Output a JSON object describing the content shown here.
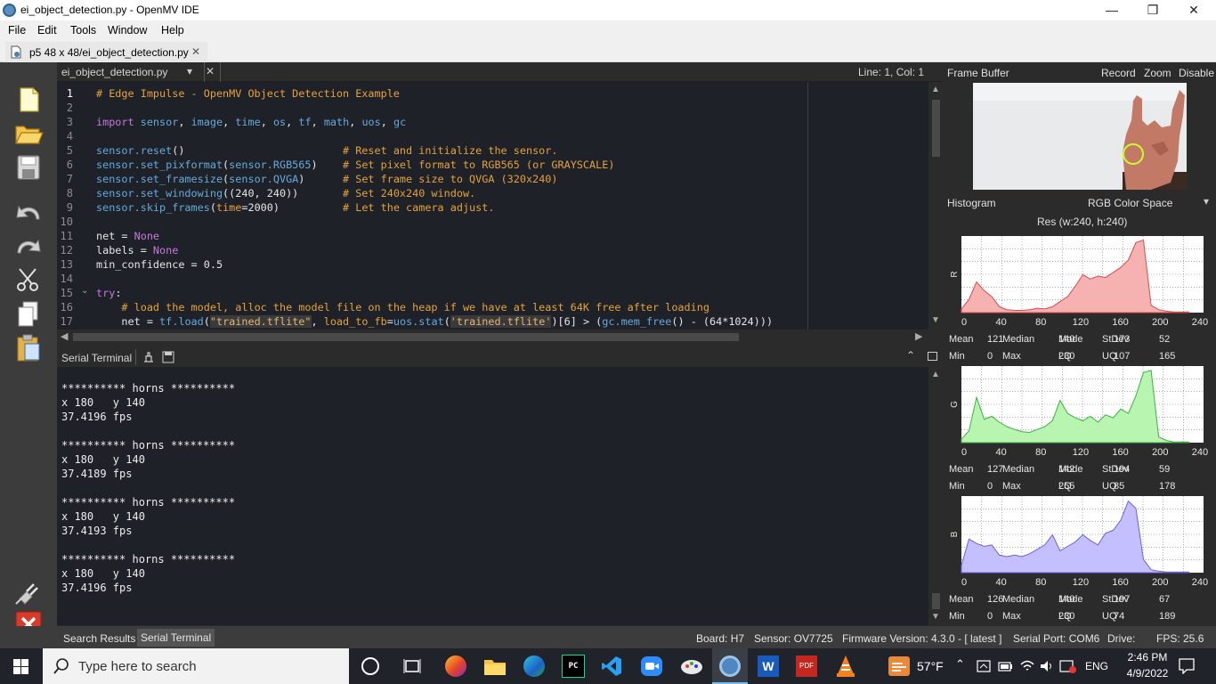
{
  "window": {
    "title": "ei_object_detection.py - OpenMV IDE",
    "minimize": "—",
    "maximize": "❐",
    "close": "✕"
  },
  "menu": [
    "File",
    "Edit",
    "Tools",
    "Window",
    "Help"
  ],
  "doc_tab": {
    "label": "p5 48 x 48/ei_object_detection.py",
    "close": "✕"
  },
  "editor": {
    "file_selector": "ei_object_detection.py",
    "file_selector_arrow": "▾",
    "file_close": "✕",
    "cursor_pos": "Line: 1, Col: 1",
    "lines": [
      {
        "n": "1",
        "parts": [
          [
            "c-cm",
            "# Edge Impulse - OpenMV Object Detection Example"
          ]
        ]
      },
      {
        "n": "2",
        "parts": []
      },
      {
        "n": "3",
        "parts": [
          [
            "c-kw",
            "import "
          ],
          [
            "c-fn",
            "sensor"
          ],
          [
            "c-pl",
            ", "
          ],
          [
            "c-fn",
            "image"
          ],
          [
            "c-pl",
            ", "
          ],
          [
            "c-fn",
            "time"
          ],
          [
            "c-pl",
            ", "
          ],
          [
            "c-fn",
            "os"
          ],
          [
            "c-pl",
            ", "
          ],
          [
            "c-fn",
            "tf"
          ],
          [
            "c-pl",
            ", "
          ],
          [
            "c-fn",
            "math"
          ],
          [
            "c-pl",
            ", "
          ],
          [
            "c-fn",
            "uos"
          ],
          [
            "c-pl",
            ", "
          ],
          [
            "c-fn",
            "gc"
          ]
        ]
      },
      {
        "n": "4",
        "parts": []
      },
      {
        "n": "5",
        "parts": [
          [
            "c-fn",
            "sensor.reset"
          ],
          [
            "c-pl",
            "()                         "
          ],
          [
            "c-cm",
            "# Reset and initialize the sensor."
          ]
        ]
      },
      {
        "n": "6",
        "parts": [
          [
            "c-fn",
            "sensor.set_pixformat"
          ],
          [
            "c-pl",
            "("
          ],
          [
            "c-fn",
            "sensor.RGB565"
          ],
          [
            "c-pl",
            ")    "
          ],
          [
            "c-cm",
            "# Set pixel format to RGB565 (or GRAYSCALE)"
          ]
        ]
      },
      {
        "n": "7",
        "parts": [
          [
            "c-fn",
            "sensor.set_framesize"
          ],
          [
            "c-pl",
            "("
          ],
          [
            "c-fn",
            "sensor.QVGA"
          ],
          [
            "c-pl",
            ")      "
          ],
          [
            "c-cm",
            "# Set frame size to QVGA (320x240)"
          ]
        ]
      },
      {
        "n": "8",
        "parts": [
          [
            "c-fn",
            "sensor.set_windowing"
          ],
          [
            "c-pl",
            "((240, 240))       "
          ],
          [
            "c-cm",
            "# Set 240x240 window."
          ]
        ]
      },
      {
        "n": "9",
        "parts": [
          [
            "c-fn",
            "sensor.skip_frames"
          ],
          [
            "c-pl",
            "("
          ],
          [
            "c-cm",
            "time"
          ],
          [
            "c-pl",
            "=2000)          "
          ],
          [
            "c-cm",
            "# Let the camera adjust."
          ]
        ]
      },
      {
        "n": "10",
        "parts": []
      },
      {
        "n": "11",
        "parts": [
          [
            "c-pl",
            "net = "
          ],
          [
            "c-kw",
            "None"
          ]
        ]
      },
      {
        "n": "12",
        "parts": [
          [
            "c-pl",
            "labels = "
          ],
          [
            "c-kw",
            "None"
          ]
        ]
      },
      {
        "n": "13",
        "parts": [
          [
            "c-pl",
            "min_confidence = 0.5"
          ]
        ]
      },
      {
        "n": "14",
        "parts": []
      },
      {
        "n": "15",
        "parts": [
          [
            "c-kw",
            "try"
          ],
          [
            "c-pl",
            ":"
          ]
        ]
      },
      {
        "n": "16",
        "parts": [
          [
            "c-pl",
            "    "
          ],
          [
            "c-cm",
            "# load the model, alloc the model file on the heap if we have at least 64K free after loading"
          ]
        ]
      },
      {
        "n": "17",
        "parts": [
          [
            "c-pl",
            "    net = "
          ],
          [
            "c-fn",
            "tf.load"
          ],
          [
            "c-pl",
            "("
          ],
          [
            "c-str",
            "\"trained.tflite\""
          ],
          [
            "c-pl",
            ", "
          ],
          [
            "c-cm",
            "load_to_fb"
          ],
          [
            "c-pl",
            "="
          ],
          [
            "c-fn",
            "uos.stat"
          ],
          [
            "c-pl",
            "("
          ],
          [
            "c-str",
            "'trained.tflite'"
          ],
          [
            "c-pl",
            ")[6] > ("
          ],
          [
            "c-fn",
            "gc.mem_free"
          ],
          [
            "c-pl",
            "() - (64*1024)))"
          ]
        ]
      }
    ]
  },
  "terminal": {
    "title": "Serial Terminal",
    "lines": [
      "",
      "********** horns **********",
      "x 180   y 140",
      "37.4196 fps",
      "",
      "********** horns **********",
      "x 180   y 140",
      "37.4189 fps",
      "",
      "********** horns **********",
      "x 180   y 140",
      "37.4193 fps",
      "",
      "********** horns **********",
      "x 180   y 140",
      "37.4196 fps"
    ]
  },
  "frame_buffer": {
    "title": "Frame Buffer",
    "record": "Record",
    "zoom": "Zoom",
    "disable": "Disable"
  },
  "histogram": {
    "title": "Histogram",
    "color_space": "RGB Color Space",
    "resolution": "Res (w:240, h:240)",
    "x_ticks": [
      "0",
      "40",
      "80",
      "120",
      "160",
      "200",
      "240"
    ],
    "channels": [
      {
        "label": "R",
        "color": "#f6b1b1",
        "stroke": "#d94a4a",
        "values": [
          0.05,
          0.18,
          0.42,
          0.3,
          0.22,
          0.08,
          0.04,
          0.03,
          0.03,
          0.04,
          0.06,
          0.05,
          0.08,
          0.15,
          0.22,
          0.36,
          0.52,
          0.46,
          0.5,
          0.48,
          0.55,
          0.62,
          0.72,
          0.96,
          0.99,
          0.1,
          0.04,
          0.02,
          0.01,
          0.01,
          0.01
        ],
        "stats": {
          "Mean": "121",
          "Median": "140",
          "Mode": "173",
          "StDev": "52",
          "Min": "0",
          "Max": "230",
          "LQ": "107",
          "UQ": "165"
        }
      },
      {
        "label": "G",
        "color": "#b8f5b0",
        "stroke": "#3cb043",
        "values": [
          0.05,
          0.16,
          0.62,
          0.32,
          0.36,
          0.28,
          0.22,
          0.18,
          0.15,
          0.14,
          0.18,
          0.22,
          0.3,
          0.58,
          0.4,
          0.34,
          0.3,
          0.36,
          0.28,
          0.38,
          0.34,
          0.46,
          0.4,
          0.64,
          0.96,
          0.99,
          0.08,
          0.03,
          0.01,
          0.01,
          0.01
        ],
        "stats": {
          "Mean": "127",
          "Median": "142",
          "Mode": "194",
          "StDev": "59",
          "Min": "0",
          "Max": "255",
          "LQ": "85",
          "UQ": "178"
        }
      },
      {
        "label": "B",
        "color": "#c4c0ff",
        "stroke": "#6a5fe0",
        "values": [
          0.1,
          0.46,
          0.4,
          0.36,
          0.38,
          0.24,
          0.22,
          0.24,
          0.22,
          0.26,
          0.32,
          0.38,
          0.52,
          0.3,
          0.36,
          0.42,
          0.52,
          0.44,
          0.38,
          0.54,
          0.58,
          0.72,
          0.98,
          0.88,
          0.18,
          0.04,
          0.02,
          0.01,
          0.01,
          0.01,
          0.01
        ],
        "stats": {
          "Mean": "126",
          "Median": "140",
          "Mode": "197",
          "StDev": "67",
          "Min": "0",
          "Max": "230",
          "LQ": "74",
          "UQ": "189"
        }
      }
    ]
  },
  "status": {
    "tab_search": "Search Results",
    "tab_terminal": "Serial Terminal",
    "board": "Board: H7",
    "sensor": "Sensor: OV7725",
    "firmware": "Firmware Version: 4.3.0 - [ latest ]",
    "port": "Serial Port: COM6",
    "drive": "Drive:",
    "fps": "FPS: 25.6"
  },
  "taskbar": {
    "search_placeholder": "Type here to search",
    "temperature": "57°F",
    "language": "ENG",
    "time": "2:46 PM",
    "date": "4/9/2022"
  }
}
